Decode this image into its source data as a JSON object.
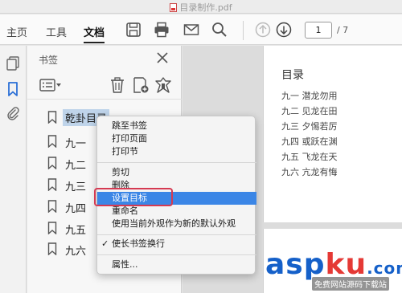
{
  "window": {
    "title": "目录制作.pdf"
  },
  "toolbar": {
    "tabs": [
      "主页",
      "工具",
      "文档"
    ],
    "page_current": "1",
    "page_total": "/ 7",
    "icons": [
      "save-icon",
      "print-icon",
      "mail-icon",
      "search-icon",
      "arrow-up-icon",
      "arrow-down-icon"
    ]
  },
  "bookmarks_panel": {
    "title": "书签",
    "items": [
      "乾卦目录",
      "九一",
      "九二",
      "九三",
      "九四",
      "九五",
      "九六"
    ]
  },
  "document": {
    "toc_title": "目录",
    "toc_lines": [
      "九一  潜龙勿用",
      "九二  见龙在田",
      "九三  夕惕若厉",
      "九四  或跃在渊",
      "九五  飞龙在天",
      "九六  亢龙有悔"
    ]
  },
  "context_menu": {
    "group1": [
      "跳至书签",
      "打印页面",
      "打印节"
    ],
    "group2": [
      "剪切",
      "删除",
      "设置目标",
      "重命名",
      "使用当前外观作为新的默认外观"
    ],
    "group3": [
      "使长书签换行"
    ],
    "group4": [
      "属性..."
    ],
    "highlighted": "设置目标",
    "check_mark": "✓"
  },
  "watermark": {
    "brand_a": "asp",
    "brand_b": "ku",
    "brand_c": ".com",
    "sub": "免费网站源码下载站"
  },
  "colors": {
    "highlight": "#3b86e6",
    "accent_blue": "#2a6fd6",
    "mark_red": "#d53a52"
  }
}
